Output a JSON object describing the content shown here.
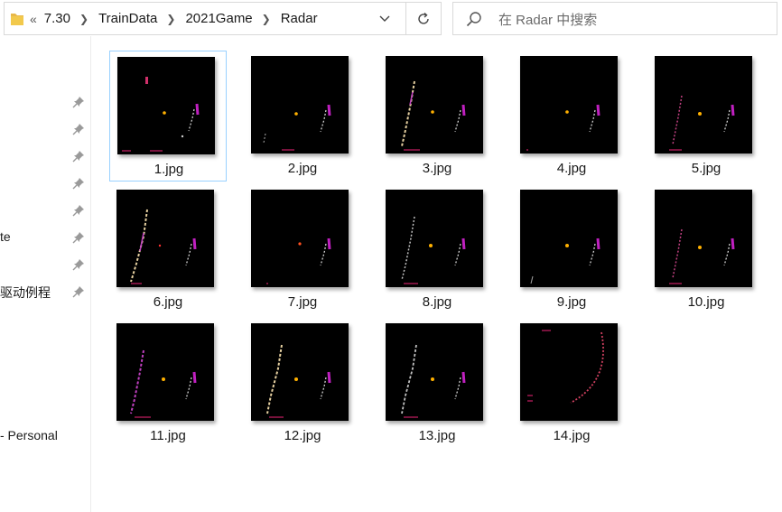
{
  "address_bar": {
    "overflow": "«",
    "crumbs": [
      "7.30",
      "TrainData",
      "2021Game",
      "Radar"
    ]
  },
  "search": {
    "placeholder": "在 Radar 中搜索"
  },
  "nav": {
    "labels": [
      "te",
      "驱动例程",
      "- Personal"
    ]
  },
  "files": [
    {
      "name": "1.jpg",
      "selected": true
    },
    {
      "name": "2.jpg"
    },
    {
      "name": "3.jpg"
    },
    {
      "name": "4.jpg"
    },
    {
      "name": "5.jpg"
    },
    {
      "name": "6.jpg"
    },
    {
      "name": "7.jpg"
    },
    {
      "name": "8.jpg"
    },
    {
      "name": "9.jpg"
    },
    {
      "name": "10.jpg"
    },
    {
      "name": "11.jpg"
    },
    {
      "name": "12.jpg"
    },
    {
      "name": "13.jpg"
    },
    {
      "name": "14.jpg"
    }
  ],
  "colors": {
    "selection_border": "#99d1ff",
    "folder": "#e8b84a",
    "pin": "#9a9a9a"
  }
}
